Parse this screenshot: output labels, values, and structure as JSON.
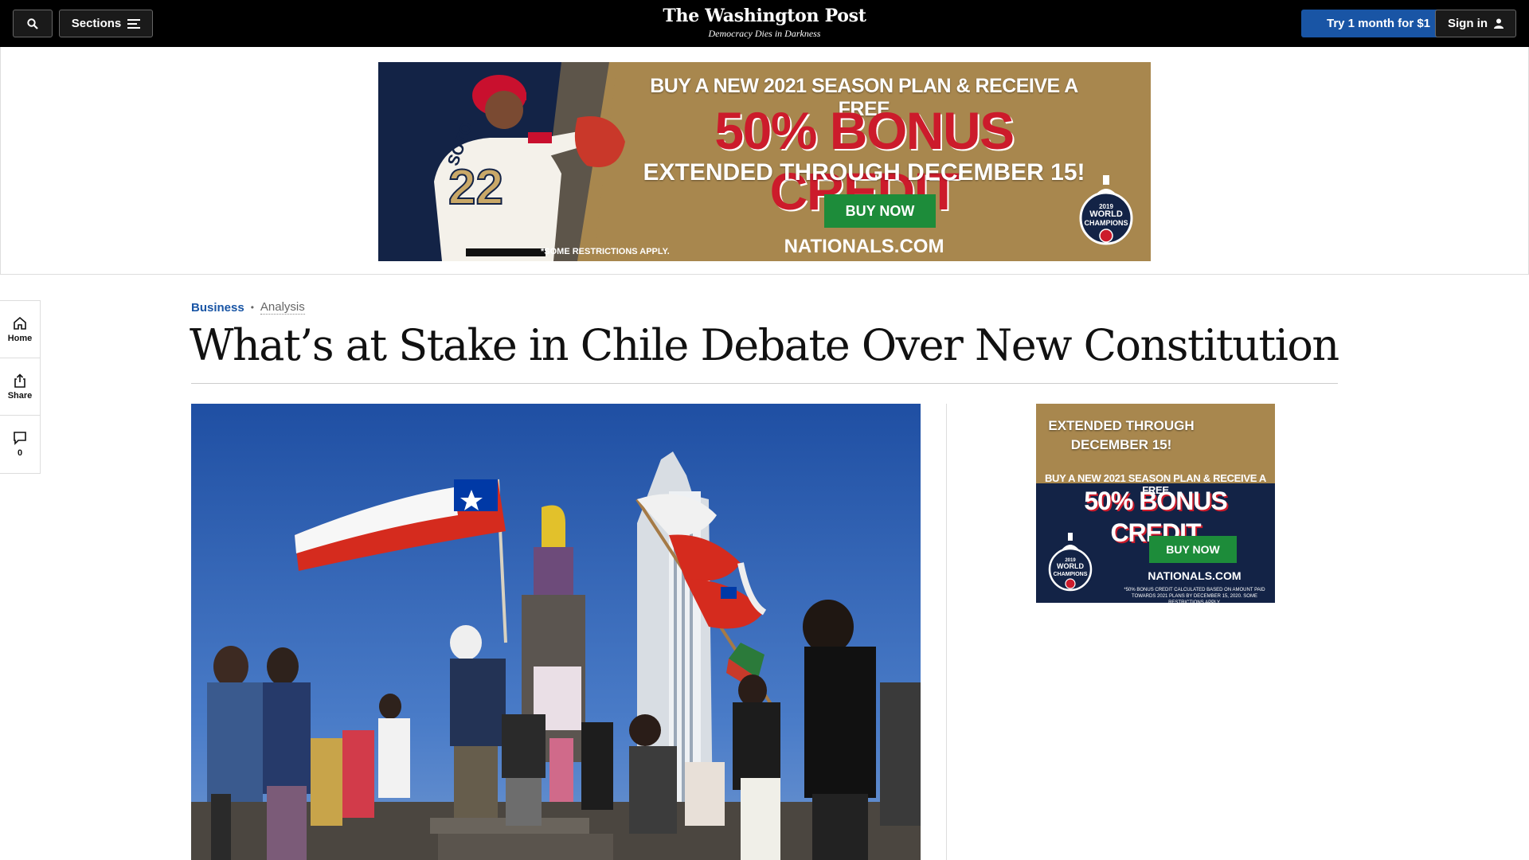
{
  "header": {
    "masthead": "The Washington Post",
    "tagline": "Democracy Dies in Darkness",
    "sections_label": "Sections",
    "subscribe_label": "Try 1 month for $1",
    "signin_label": "Sign in"
  },
  "top_ad": {
    "line1": "BUY A NEW 2021 SEASON PLAN & RECEIVE A FREE",
    "line2": "50% BONUS CREDIT",
    "line3": "EXTENDED THROUGH DECEMBER 15!",
    "cta": "BUY NOW",
    "restrictions": "*SOME RESTRICTIONS APPLY.",
    "site": "NATIONALS.COM",
    "jersey_name": "SOTO",
    "jersey_number": "22",
    "badge_line1": "2019",
    "badge_line2": "WORLD",
    "badge_line3": "CHAMPIONS"
  },
  "rail": {
    "home_label": "Home",
    "share_label": "Share",
    "comments_count": "0"
  },
  "article": {
    "section": "Business",
    "label": "Analysis",
    "headline": "What’s at Stake in Chile Debate Over New Constitution"
  },
  "side_ad": {
    "line1": "EXTENDED THROUGH DECEMBER 15!",
    "line2": "BUY A NEW 2021 SEASON PLAN & RECEIVE A FREE",
    "line3": "50% BONUS CREDIT",
    "cta": "BUY NOW",
    "site": "NATIONALS.COM",
    "fine_print": "*50% BONUS CREDIT CALCULATED BASED ON AMOUNT PAID TOWARDS 2021 PLANS BY DECEMBER 15, 2020. SOME RESTRICTIONS APPLY.",
    "badge_line1": "2019",
    "badge_line2": "WORLD",
    "badge_line3": "CHAMPIONS"
  },
  "colors": {
    "topbar": "#000000",
    "accent_blue": "#1955a5",
    "ad_gold": "#a8874e",
    "ad_navy": "#132346",
    "ad_red": "#cc1b2b",
    "ad_green": "#1d8c3a"
  }
}
